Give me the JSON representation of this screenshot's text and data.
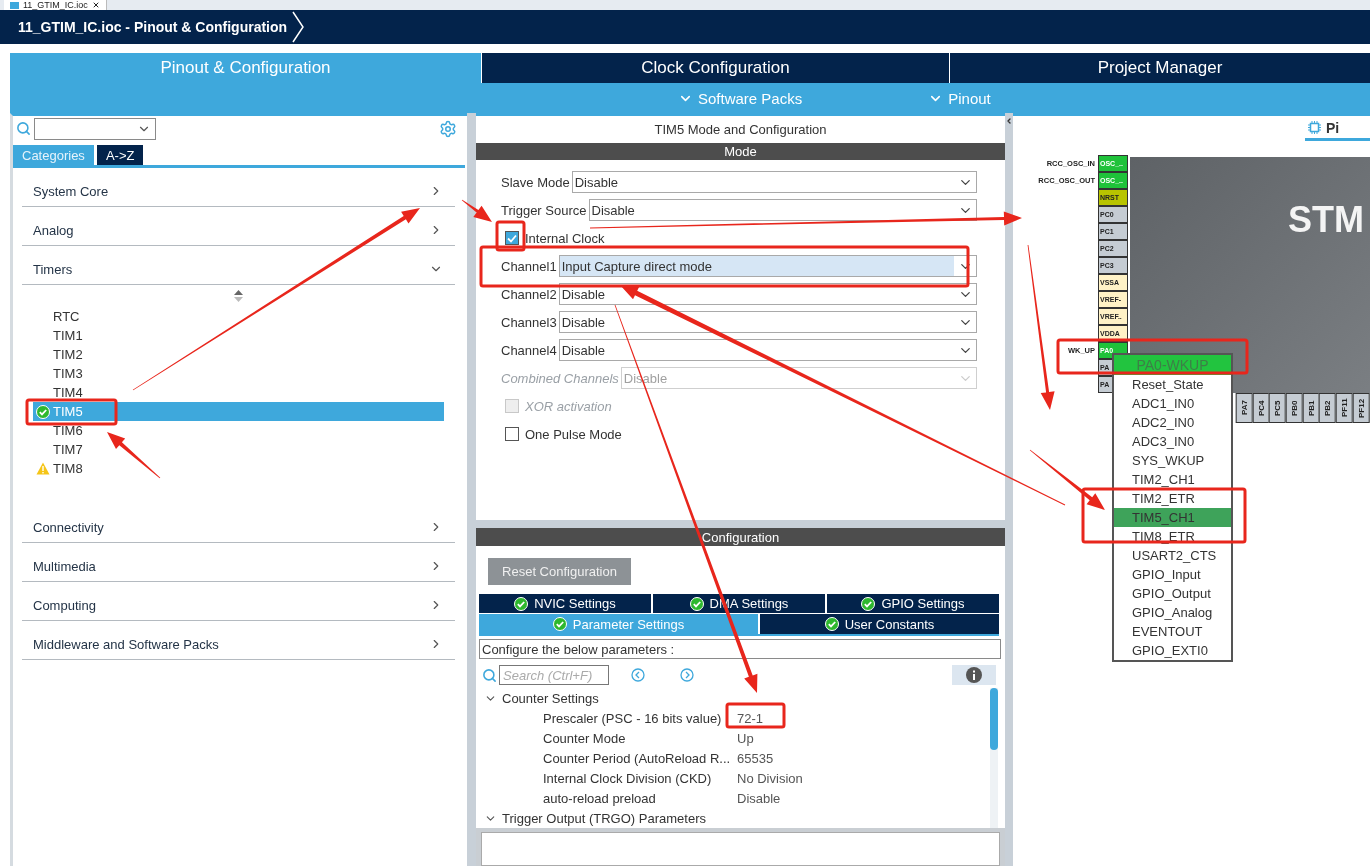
{
  "file_tab": {
    "title": "11_GTIM_IC.ioc"
  },
  "breadcrumb": {
    "label": "11_GTIM_IC.ioc - Pinout & Configuration"
  },
  "main_tabs": [
    {
      "label": "Pinout & Configuration",
      "selected": true
    },
    {
      "label": "Clock Configuration",
      "selected": false
    },
    {
      "label": "Project Manager",
      "selected": false
    }
  ],
  "sub_menu": [
    {
      "label": "Software Packs"
    },
    {
      "label": "Pinout"
    }
  ],
  "left_panel": {
    "tabs": [
      {
        "label": "Categories",
        "selected": true
      },
      {
        "label": "A->Z",
        "selected": false
      }
    ],
    "categories": [
      {
        "label": "System Core",
        "expanded": false
      },
      {
        "label": "Analog",
        "expanded": false
      },
      {
        "label": "Timers",
        "expanded": true,
        "children": [
          {
            "label": "RTC",
            "selected": false,
            "configured": false,
            "warning": false
          },
          {
            "label": "TIM1",
            "selected": false,
            "configured": false,
            "warning": false
          },
          {
            "label": "TIM2",
            "selected": false,
            "configured": false,
            "warning": false
          },
          {
            "label": "TIM3",
            "selected": false,
            "configured": false,
            "warning": false
          },
          {
            "label": "TIM4",
            "selected": false,
            "configured": false,
            "warning": false
          },
          {
            "label": "TIM5",
            "selected": true,
            "configured": true,
            "warning": false
          },
          {
            "label": "TIM6",
            "selected": false,
            "configured": false,
            "warning": false
          },
          {
            "label": "TIM7",
            "selected": false,
            "configured": false,
            "warning": false
          },
          {
            "label": "TIM8",
            "selected": false,
            "configured": false,
            "warning": true
          }
        ]
      },
      {
        "label": "Connectivity",
        "expanded": false
      },
      {
        "label": "Multimedia",
        "expanded": false
      },
      {
        "label": "Computing",
        "expanded": false
      },
      {
        "label": "Middleware and Software Packs",
        "expanded": false
      }
    ]
  },
  "mode_panel": {
    "title": "TIM5 Mode and Configuration",
    "header": "Mode",
    "fields": [
      {
        "kind": "select",
        "label": "Slave Mode",
        "value": "Disable",
        "disabled": false,
        "focused": false
      },
      {
        "kind": "select",
        "label": "Trigger Source",
        "value": "Disable",
        "disabled": false,
        "focused": false
      },
      {
        "kind": "checkbox",
        "label": "Internal Clock",
        "checked": true,
        "disabled": false
      },
      {
        "kind": "select",
        "label": "Channel1",
        "value": "Input Capture direct mode",
        "disabled": false,
        "focused": true
      },
      {
        "kind": "select",
        "label": "Channel2",
        "value": "Disable",
        "disabled": false,
        "focused": false
      },
      {
        "kind": "select",
        "label": "Channel3",
        "value": "Disable",
        "disabled": false,
        "focused": false
      },
      {
        "kind": "select",
        "label": "Channel4",
        "value": "Disable",
        "disabled": false,
        "focused": false
      },
      {
        "kind": "select",
        "label": "Combined Channels",
        "value": "Disable",
        "disabled": true,
        "focused": false
      },
      {
        "kind": "checkbox",
        "label": "XOR activation",
        "checked": false,
        "disabled": true
      },
      {
        "kind": "checkbox",
        "label": "One Pulse Mode",
        "checked": false,
        "disabled": false
      }
    ]
  },
  "config_panel": {
    "header": "Configuration",
    "reset_button": "Reset Configuration",
    "tabs_top": [
      {
        "label": "NVIC Settings",
        "selected": false
      },
      {
        "label": "DMA Settings",
        "selected": false
      },
      {
        "label": "GPIO Settings",
        "selected": false
      }
    ],
    "tabs_bottom": [
      {
        "label": "Parameter Settings",
        "selected": true
      },
      {
        "label": "User Constants",
        "selected": false
      }
    ],
    "description": "Configure the below parameters :",
    "search": {
      "placeholder": "Search (Ctrl+F)"
    },
    "groups": [
      {
        "label": "Counter Settings",
        "expanded": true,
        "params": [
          {
            "name": "Prescaler (PSC - 16 bits value)",
            "value": "72-1"
          },
          {
            "name": "Counter Mode",
            "value": "Up"
          },
          {
            "name": "Counter Period (AutoReload R...",
            "value": "65535"
          },
          {
            "name": "Internal Clock Division (CKD)",
            "value": "No Division"
          },
          {
            "name": "auto-reload preload",
            "value": "Disable"
          }
        ]
      },
      {
        "label": "Trigger Output (TRGO) Parameters",
        "expanded": true
      }
    ]
  },
  "pinout_view": {
    "tab": "Pi",
    "chip_label": "STM",
    "pins_left": [
      {
        "name": "OSC_..",
        "signal": "RCC_OSC_IN",
        "color": "#1fc23a"
      },
      {
        "name": "OSC_..",
        "signal": "RCC_OSC_OUT",
        "color": "#1fc23a"
      },
      {
        "name": "NRST",
        "color": "#b8c400"
      },
      {
        "name": "PC0",
        "color": "#c5ccd3"
      },
      {
        "name": "PC1",
        "color": "#c5ccd3"
      },
      {
        "name": "PC2",
        "color": "#c5ccd3"
      },
      {
        "name": "PC3",
        "color": "#c5ccd3"
      },
      {
        "name": "VSSA",
        "color": "#fff2c6"
      },
      {
        "name": "VREF-",
        "color": "#fff2c6"
      },
      {
        "name": "VREF..",
        "color": "#fff2c6"
      },
      {
        "name": "VDDA",
        "color": "#fff2c6"
      },
      {
        "name": "PA0",
        "signal": "WK_UP",
        "color": "#1fc23a"
      },
      {
        "name": "PA",
        "color": "#c5ccd3"
      },
      {
        "name": "PA",
        "color": "#c5ccd3"
      }
    ],
    "pins_bottom": [
      {
        "name": "PA7"
      },
      {
        "name": "PC4"
      },
      {
        "name": "PC5"
      },
      {
        "name": "PB0"
      },
      {
        "name": "PB1"
      },
      {
        "name": "PB2"
      },
      {
        "name": "PF11"
      },
      {
        "name": "PF12"
      }
    ],
    "pin_menu": {
      "title": "PA0-WKUP",
      "items": [
        {
          "label": "Reset_State",
          "selected": false
        },
        {
          "label": "ADC1_IN0",
          "selected": false
        },
        {
          "label": "ADC2_IN0",
          "selected": false
        },
        {
          "label": "ADC3_IN0",
          "selected": false
        },
        {
          "label": "SYS_WKUP",
          "selected": false
        },
        {
          "label": "TIM2_CH1",
          "selected": false
        },
        {
          "label": "TIM2_ETR",
          "selected": false
        },
        {
          "label": "TIM5_CH1",
          "selected": true
        },
        {
          "label": "TIM8_ETR",
          "selected": false
        },
        {
          "label": "USART2_CTS",
          "selected": false
        },
        {
          "label": "GPIO_Input",
          "selected": false
        },
        {
          "label": "GPIO_Output",
          "selected": false
        },
        {
          "label": "GPIO_Analog",
          "selected": false
        },
        {
          "label": "EVENTOUT",
          "selected": false
        },
        {
          "label": "GPIO_EXTI0",
          "selected": false
        }
      ]
    }
  }
}
